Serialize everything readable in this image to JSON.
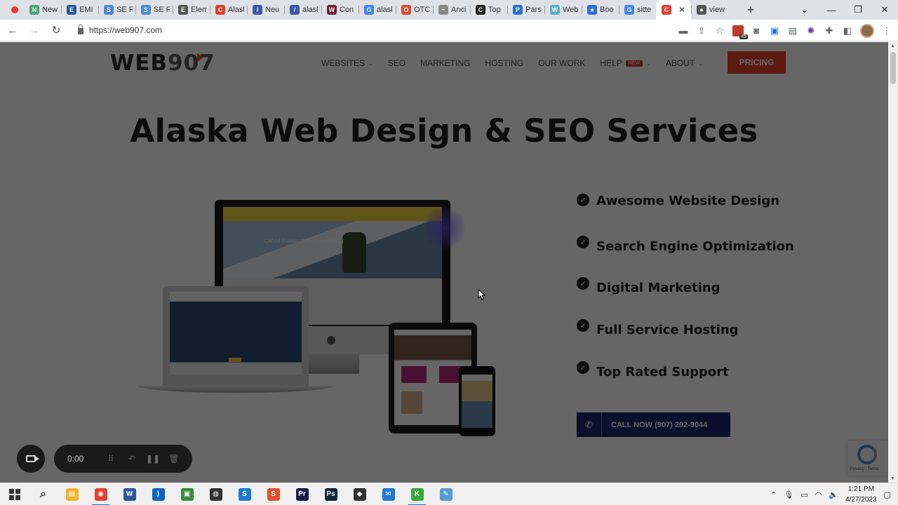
{
  "browser": {
    "tabs": [
      {
        "title": "New",
        "favicon_color": "#4aa37a",
        "glyph": "N"
      },
      {
        "title": "EMI",
        "favicon_color": "#2b579a",
        "glyph": "E"
      },
      {
        "title": "SE R",
        "favicon_color": "#4a8ad4",
        "glyph": "S"
      },
      {
        "title": "SE R",
        "favicon_color": "#4a8ad4",
        "glyph": "S"
      },
      {
        "title": "Elem",
        "favicon_color": "#555555",
        "glyph": "E"
      },
      {
        "title": "Alasl",
        "favicon_color": "#e3402d",
        "glyph": "C"
      },
      {
        "title": "Neu",
        "favicon_color": "#3c5aa8",
        "glyph": "/"
      },
      {
        "title": "alasl",
        "favicon_color": "#3c5aa8",
        "glyph": "/"
      },
      {
        "title": "Con",
        "favicon_color": "#6b2138",
        "glyph": "W"
      },
      {
        "title": "alasl",
        "favicon_color": "#4285f4",
        "glyph": "G"
      },
      {
        "title": "OTC",
        "favicon_color": "#d94a2f",
        "glyph": "O"
      },
      {
        "title": "Anci",
        "favicon_color": "#888888",
        "glyph": "~"
      },
      {
        "title": "Top",
        "favicon_color": "#222222",
        "glyph": "C"
      },
      {
        "title": "Pars",
        "favicon_color": "#2a6fd6",
        "glyph": "P"
      },
      {
        "title": "Web",
        "favicon_color": "#5bb0c8",
        "glyph": "W"
      },
      {
        "title": "Boo",
        "favicon_color": "#2a6fd6",
        "glyph": "★"
      },
      {
        "title": "sitte",
        "favicon_color": "#4285f4",
        "glyph": "G"
      },
      {
        "title": "",
        "favicon_color": "#e3402d",
        "glyph": "C",
        "active": true
      },
      {
        "title": "view",
        "favicon_color": "#555555",
        "glyph": "●"
      }
    ],
    "new_tab_icon": "plus-icon",
    "window_controls": {
      "minimize": "—",
      "maximize": "❐",
      "close": "✕",
      "dropdown": "⌄"
    },
    "url": "https://web907.com",
    "extension_badge": "45"
  },
  "site": {
    "logo": {
      "text": "WEB",
      "number": "907"
    },
    "nav": [
      {
        "label": "WEBSITES",
        "has_caret": true
      },
      {
        "label": "SEO",
        "has_caret": false
      },
      {
        "label": "MARKETING",
        "has_caret": false
      },
      {
        "label": "HOSTING",
        "has_caret": false
      },
      {
        "label": "OUR WORK",
        "has_caret": false
      },
      {
        "label": "HELP",
        "has_caret": true,
        "badge": "NEW"
      },
      {
        "label": "ABOUT",
        "has_caret": true
      }
    ],
    "pricing_label": "PRICING",
    "hero_title": "Alaska Web Design & SEO Services",
    "mockup_caption": "CNSM Research is Outstanding",
    "features": [
      "Awesome Website Design",
      "Search Engine Optimization",
      "Digital Marketing",
      "Full Service Hosting",
      "Top Rated Support"
    ],
    "call_button": "CALL NOW (907) 202-9044",
    "recaptcha_text": "Privacy - Terms",
    "accent_color": "#e8432c",
    "cta_color": "#1a2a6c"
  },
  "recorder": {
    "time": "0:00"
  },
  "taskbar": {
    "apps": [
      {
        "name": "search",
        "color": "#333333",
        "glyph": "⌕"
      },
      {
        "name": "file-explorer",
        "color": "#f0b429",
        "glyph": "▤"
      },
      {
        "name": "chrome",
        "color": "#e3402d",
        "glyph": "◉",
        "active": true
      },
      {
        "name": "word",
        "color": "#2b579a",
        "glyph": "W"
      },
      {
        "name": "vscode",
        "color": "#0a66c2",
        "glyph": "⟩"
      },
      {
        "name": "app-green",
        "color": "#3a8a3a",
        "glyph": "▣"
      },
      {
        "name": "game-controller",
        "color": "#333333",
        "glyph": "◍"
      },
      {
        "name": "app-s-blue",
        "color": "#1e78d0",
        "glyph": "S"
      },
      {
        "name": "app-s-orange",
        "color": "#e2502c",
        "glyph": "S"
      },
      {
        "name": "premiere",
        "color": "#1a1a4a",
        "glyph": "Pr"
      },
      {
        "name": "photoshop",
        "color": "#0d2540",
        "glyph": "Ps"
      },
      {
        "name": "davinci",
        "color": "#333333",
        "glyph": "◆"
      },
      {
        "name": "mail",
        "color": "#1e78d0",
        "glyph": "✉"
      },
      {
        "name": "app-k",
        "color": "#3aa63a",
        "glyph": "K",
        "active": true
      },
      {
        "name": "app-pen",
        "color": "#5a9ad4",
        "glyph": "✎"
      }
    ],
    "time": "1:21 PM",
    "date": "4/27/2023"
  }
}
